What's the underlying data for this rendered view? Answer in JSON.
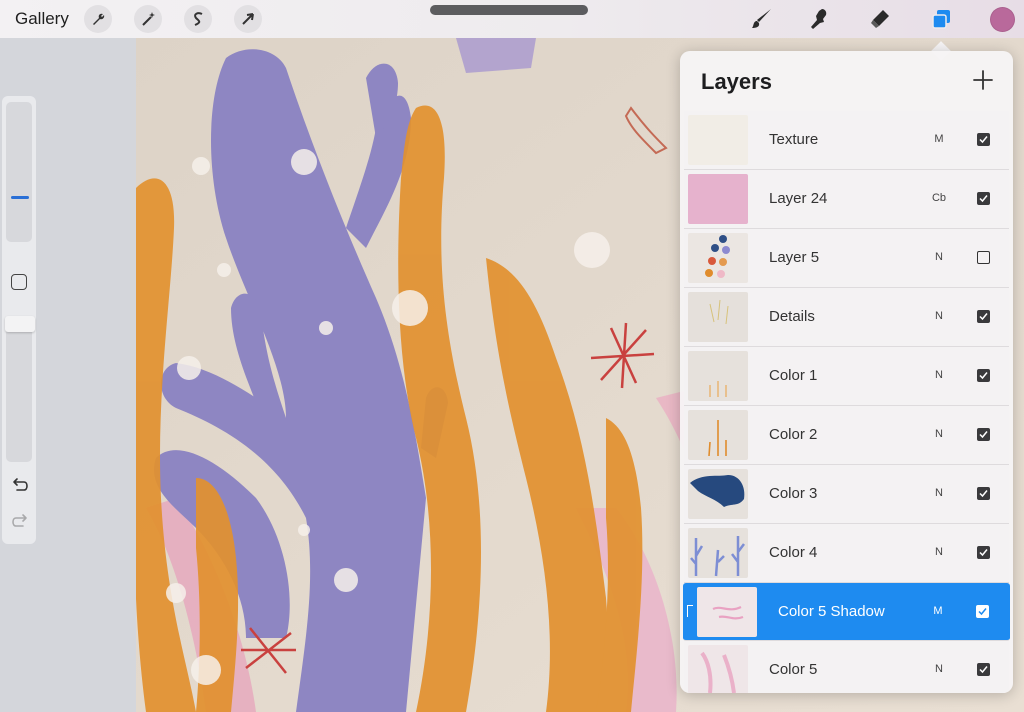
{
  "top_bar": {
    "gallery_label": "Gallery",
    "left_tools": [
      "wrench-icon",
      "magic-wand-icon",
      "selection-s-icon",
      "transform-arrow-icon"
    ],
    "right_tools": [
      "brush-icon",
      "smudge-icon",
      "eraser-icon",
      "layers-icon"
    ],
    "active_tool": "layers-icon",
    "color_swatch": "#b9699b"
  },
  "layers": {
    "title": "Layers",
    "add_icon": "plus-icon",
    "items": [
      {
        "name": "Texture",
        "mode": "M",
        "visible": true
      },
      {
        "name": "Layer 24",
        "mode": "Cb",
        "visible": true
      },
      {
        "name": "Layer 5",
        "mode": "N",
        "visible": false
      },
      {
        "name": "Details",
        "mode": "N",
        "visible": true
      },
      {
        "name": "Color 1",
        "mode": "N",
        "visible": true
      },
      {
        "name": "Color 2",
        "mode": "N",
        "visible": true
      },
      {
        "name": "Color 3",
        "mode": "N",
        "visible": true
      },
      {
        "name": "Color 4",
        "mode": "N",
        "visible": true
      },
      {
        "name": "Color 5 Shadow",
        "mode": "M",
        "visible": true,
        "selected": true
      },
      {
        "name": "Color 5",
        "mode": "N",
        "visible": true
      }
    ]
  },
  "colors": {
    "accent": "#1e8bf0",
    "coral_purple": "#8e86c2",
    "kelp_orange": "#e2912f",
    "canvas_beige": "#e4d9cc"
  }
}
